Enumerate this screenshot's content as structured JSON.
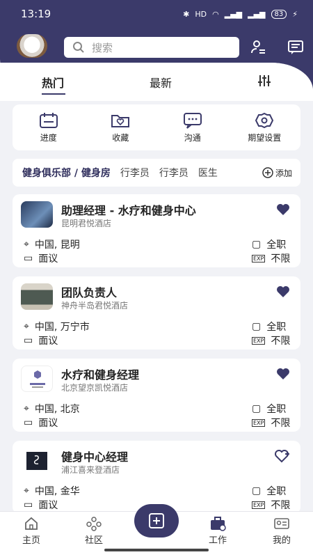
{
  "status": {
    "time": "13:19",
    "battery": "83"
  },
  "search": {
    "placeholder": "搜索"
  },
  "tabs": [
    {
      "label": "热门"
    },
    {
      "label": "最新"
    }
  ],
  "quick_actions": [
    {
      "label": "进度",
      "icon": "calendar-icon"
    },
    {
      "label": "收藏",
      "icon": "heart-folder-icon"
    },
    {
      "label": "沟通",
      "icon": "chat-icon"
    },
    {
      "label": "期望设置",
      "icon": "settings-icon"
    }
  ],
  "categories": {
    "active": "健身俱乐部 / 健身房",
    "items": [
      "行李员",
      "行李员",
      "医生"
    ],
    "add_label": "添加"
  },
  "jobs": [
    {
      "title": "助理经理 - 水疗和健身中心",
      "company": "昆明君悦酒店",
      "location": "中国, 昆明",
      "salary": "面议",
      "type": "全职",
      "experience": "不限",
      "favorited": true
    },
    {
      "title": "团队负责人",
      "company": "神舟半岛君悦酒店",
      "location": "中国, 万宁市",
      "salary": "面议",
      "type": "全职",
      "experience": "不限",
      "favorited": true
    },
    {
      "title": "水疗和健身经理",
      "company": "北京望京凯悦酒店",
      "location": "中国, 北京",
      "salary": "面议",
      "type": "全职",
      "experience": "不限",
      "favorited": true
    },
    {
      "title": "健身中心经理",
      "company": "浦江喜来登酒店",
      "location": "中国, 金华",
      "salary": "面议",
      "type": "全职",
      "experience": "不限",
      "favorited": false
    }
  ],
  "nav": [
    {
      "label": "主页"
    },
    {
      "label": "社区"
    },
    {
      "label": "工作"
    },
    {
      "label": "我的"
    }
  ],
  "colors": {
    "primary": "#3b3a6a"
  }
}
